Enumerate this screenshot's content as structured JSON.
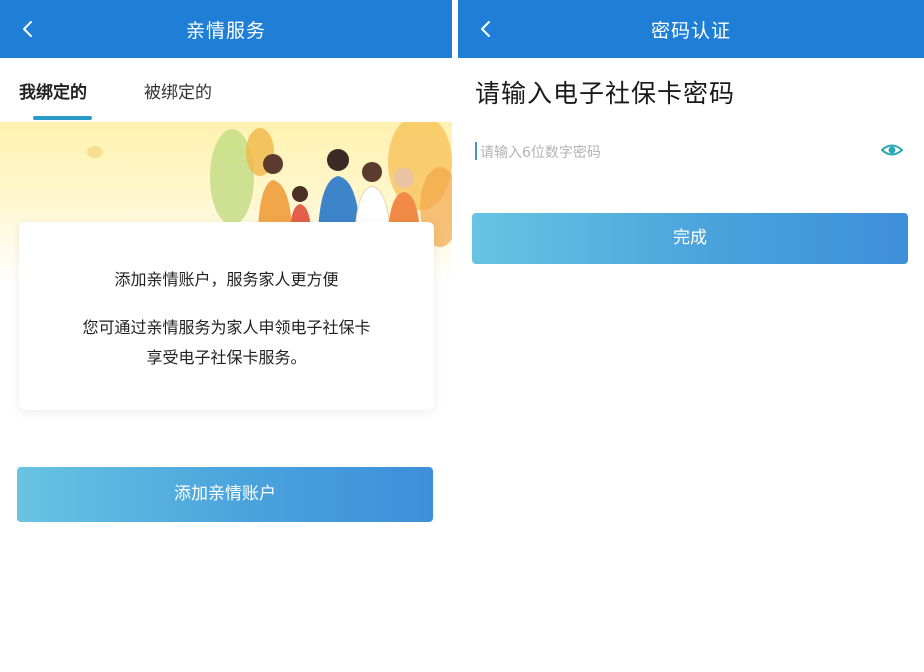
{
  "left_screen": {
    "nav_title": "亲情服务",
    "tabs": [
      {
        "label": "我绑定的",
        "active": true
      },
      {
        "label": "被绑定的",
        "active": false
      }
    ],
    "card": {
      "title": "添加亲情账户，服务家人更方便",
      "line1": "您可通过亲情服务为家人申领电子社保卡",
      "line2": "享受电子社保卡服务。"
    },
    "add_button_label": "添加亲情账户"
  },
  "right_screen": {
    "nav_title": "密码认证",
    "heading": "请输入电子社保卡密码",
    "password_placeholder": "请输入6位数字密码",
    "password_value": "",
    "done_button_label": "完成"
  },
  "icons": {
    "back": "chevron-left-icon",
    "eye": "eye-icon"
  },
  "colors": {
    "nav_bar": "#1f7ed6",
    "tab_underline": "#2a9bc9",
    "button_start": "#69c3e2",
    "button_end": "#3e8fd9"
  }
}
